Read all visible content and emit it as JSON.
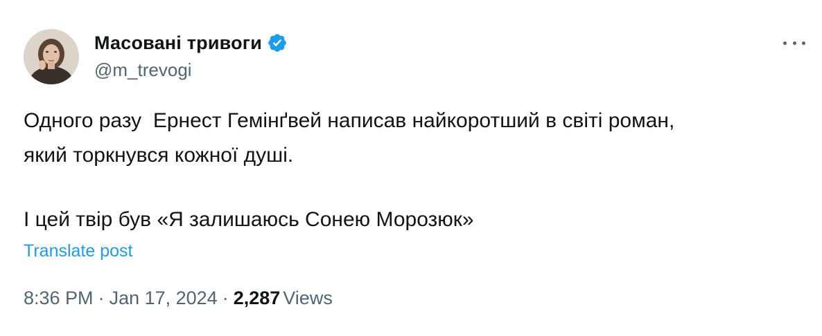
{
  "author": {
    "display_name": "Масовані тривоги",
    "handle": "@m_trevogi",
    "verified": true
  },
  "post": {
    "line1": "Одного разу  Ернест Гемінґвей написав найкоротший в світі роман,",
    "line2": "який торкнувся кожної душі.",
    "line3": "І цей твір був «Я залишаюсь Сонею Морозюк»",
    "translate_label": "Translate post"
  },
  "meta": {
    "time": "8:36 PM",
    "separator": "·",
    "date": "Jan 17, 2024",
    "views_count": "2,287",
    "views_label": "Views"
  },
  "colors": {
    "text": "#0f1419",
    "secondary": "#536471",
    "accent": "#1d9bf0"
  },
  "icons": {
    "verified": "verified-badge-icon",
    "more": "more-options-icon"
  }
}
